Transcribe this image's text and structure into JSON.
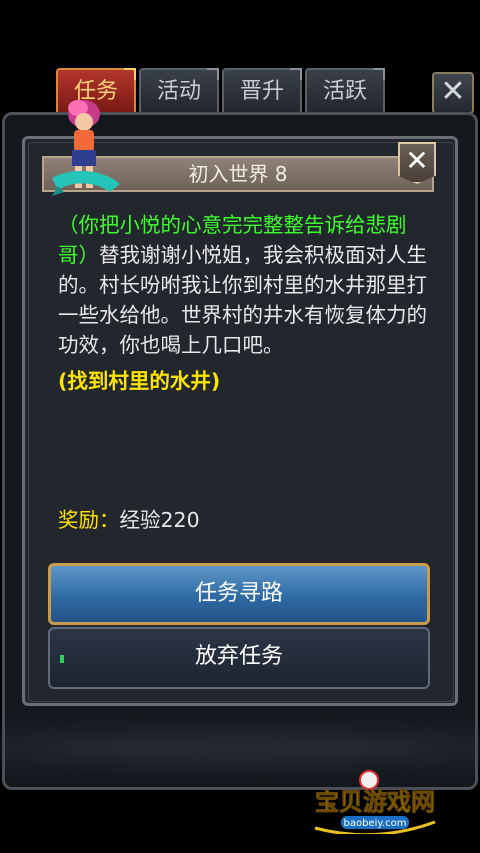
{
  "tabs": [
    {
      "label": "任务",
      "active": true
    },
    {
      "label": "活动",
      "active": false
    },
    {
      "label": "晋升",
      "active": false
    },
    {
      "label": "活跃",
      "active": false
    }
  ],
  "close_icon": "✕",
  "quest": {
    "title": "初入世界 8",
    "narration": "（你把小悦的心意完完整整告诉给悲剧哥）",
    "dialogue": "替我谢谢小悦姐，我会积极面对人生的。村长吩咐我让你到村里的水井那里打一些水给他。世界村的井水有恢复体力的功效，你也喝上几口吧。",
    "objective": "(找到村里的水井)",
    "reward_label": "奖励：",
    "reward_value": "经验220"
  },
  "buttons": {
    "pathfind": "任务寻路",
    "abandon": "放弃任务"
  },
  "watermark": {
    "name": "宝贝游戏网",
    "url": "baobeiy.com"
  },
  "colors": {
    "narration": "#3cff2a",
    "highlight": "#ffe400",
    "active_tab": "#b2352b",
    "primary_button": "#2f6aa3"
  }
}
